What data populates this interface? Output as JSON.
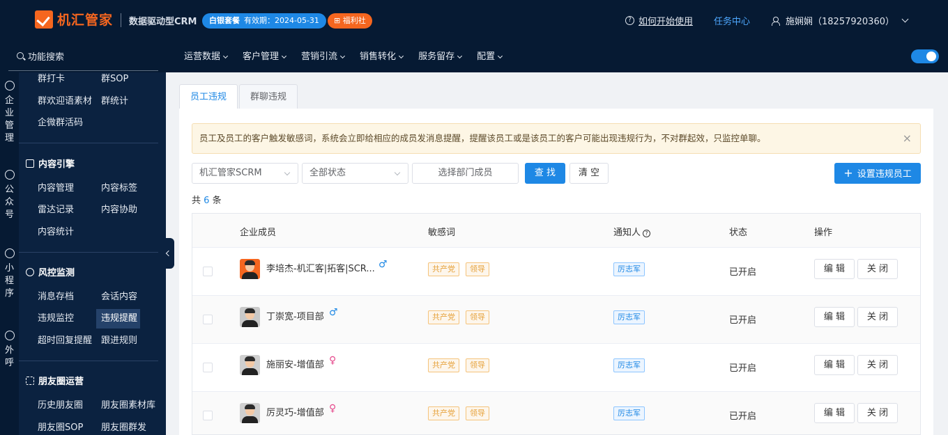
{
  "header": {
    "logo_text": "机汇管家",
    "subtitle": "数据驱动型CRM",
    "plan_badge": "白银套餐",
    "plan_expiry": "有效期：2024-05-31",
    "gift_badge": "福利社",
    "help_label": "如何开始使用",
    "task_center": "任务中心",
    "user_label": "施娴娴（18257920360）"
  },
  "nav": {
    "search_label": "功能搜索",
    "menu": [
      "运营数据",
      "客户管理",
      "营销引流",
      "销售转化",
      "服务留存",
      "配置"
    ],
    "toggle_on": true
  },
  "rail": [
    {
      "icon": "wechat-icon",
      "label": "企业管理"
    },
    {
      "icon": "chat-bubble-icon",
      "label": "公众号"
    },
    {
      "icon": "compass-icon",
      "label": "小程序"
    },
    {
      "icon": "phone-icon",
      "label": "外呼"
    }
  ],
  "sidebar": {
    "top_rows": [
      [
        "群打卡",
        "群SOP"
      ],
      [
        "群欢迎语素材",
        "群统计"
      ],
      [
        "企微群活码"
      ]
    ],
    "sections": [
      {
        "icon": "document-icon",
        "title": "内容引擎",
        "rows": [
          [
            "内容管理",
            "内容标签"
          ],
          [
            "雷达记录",
            "内容协助"
          ],
          [
            "内容统计"
          ]
        ]
      },
      {
        "icon": "microphone-icon",
        "title": "风控监测",
        "rows": [
          [
            "消息存档",
            "会话内容"
          ],
          [
            "违规监控",
            "违规提醒"
          ],
          [
            "超时回复提醒",
            "跟进规则"
          ]
        ]
      },
      {
        "icon": "grid-icon",
        "title": "朋友圈运营",
        "rows": [
          [
            "历史朋友圈",
            "朋友圈素材库"
          ],
          [
            "朋友圈SOP",
            "朋友圈群发"
          ]
        ]
      }
    ],
    "active_item": "违规提醒"
  },
  "tabs": [
    {
      "label": "员工违规",
      "active": true
    },
    {
      "label": "群聊违规",
      "active": false
    }
  ],
  "alert": {
    "text": "员工及员工的客户触发敏感词，系统会立即给相应的成员发消息提醒，提醒该员工或是该员工的客户可能出现违规行为，不对群起效，只监控单聊。",
    "close": "×"
  },
  "filters": {
    "account": "机汇管家SCRM",
    "status": "全部状态",
    "member_placeholder": "选择部门成员",
    "search_btn": "查 找",
    "clear_btn": "清 空",
    "add_btn": "设置违规员工"
  },
  "count": {
    "prefix": "共",
    "n": "6",
    "suffix": "条"
  },
  "table": {
    "columns": [
      "企业成员",
      "敏感词",
      "通知人",
      "状态",
      "操作"
    ],
    "rows": [
      {
        "name": "李培杰-机汇客|拓客|SCR...",
        "gender": "♂",
        "gender_type": "m",
        "tags": [
          "共产党",
          "领导"
        ],
        "notifier": "厉志军",
        "status": "已开启",
        "edit": "编 辑",
        "close": "关 闭",
        "avatar_color": "#f5661f"
      },
      {
        "name": "丁崇宽-项目部",
        "gender": "♂",
        "gender_type": "m",
        "tags": [
          "共产党",
          "领导"
        ],
        "notifier": "厉志军",
        "status": "已开启",
        "edit": "编 辑",
        "close": "关 闭",
        "avatar_color": "#c9c9c9"
      },
      {
        "name": "施丽安-增值部",
        "gender": "♀",
        "gender_type": "f",
        "tags": [
          "共产党",
          "领导"
        ],
        "notifier": "厉志军",
        "status": "已开启",
        "edit": "编 辑",
        "close": "关 闭",
        "avatar_color": "#cfcfcf"
      },
      {
        "name": "厉灵巧-增值部",
        "gender": "♀",
        "gender_type": "f",
        "tags": [
          "共产党",
          "领导"
        ],
        "notifier": "厉志军",
        "status": "已开启",
        "edit": "编 辑",
        "close": "关 闭",
        "avatar_color": "#cfcfcf"
      }
    ]
  },
  "colors": {
    "brand": "#f5661f",
    "primary": "#1e88e5",
    "dark_bg": "#061a33"
  }
}
